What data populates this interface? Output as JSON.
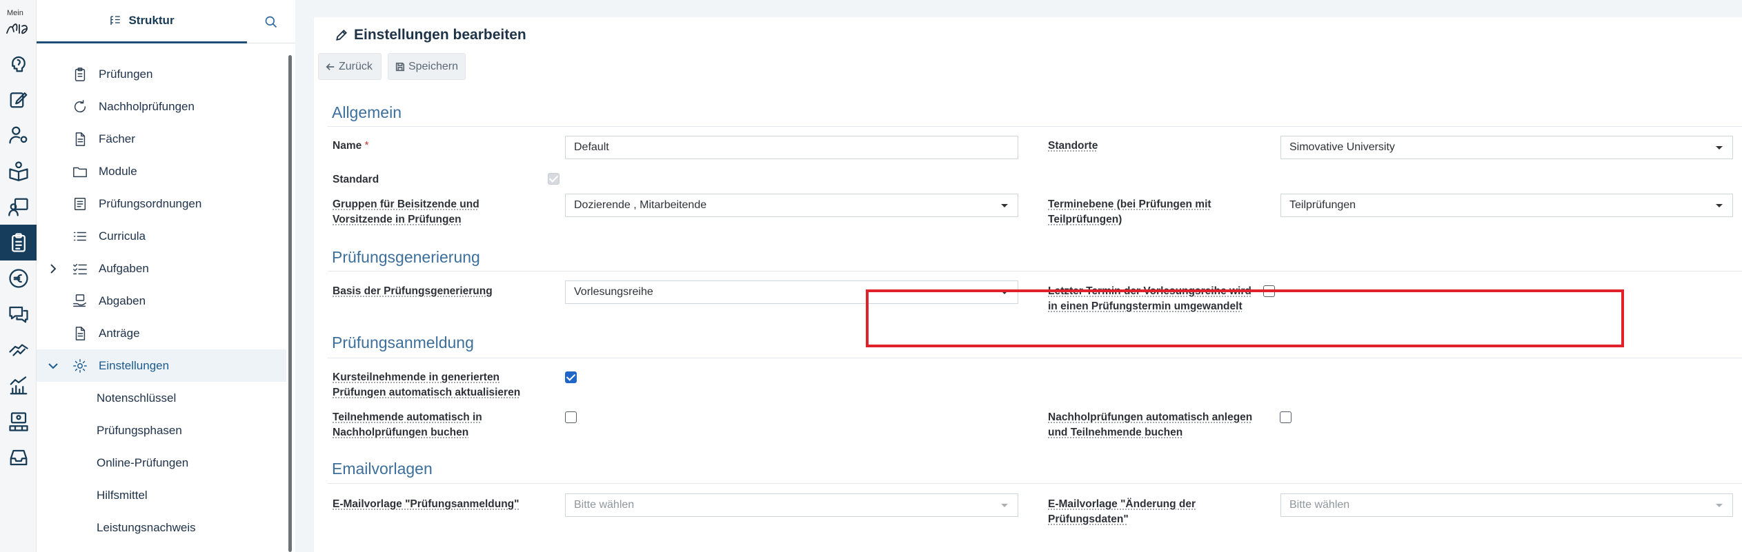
{
  "rail": {
    "logo_text": "Mein",
    "items": [
      {
        "name": "lightbulb-head-icon",
        "active": false
      },
      {
        "name": "edit-icon",
        "active": false
      },
      {
        "name": "user-settings-icon",
        "active": false
      },
      {
        "name": "book-person-icon",
        "active": false
      },
      {
        "name": "teacher-icon",
        "active": false
      },
      {
        "name": "clipboard-icon",
        "active": true
      },
      {
        "name": "euro-icon",
        "active": false
      },
      {
        "name": "chat-icon",
        "active": false
      },
      {
        "name": "handshake-icon",
        "active": false
      },
      {
        "name": "statistics-icon",
        "active": false
      },
      {
        "name": "monitor-person-icon",
        "active": false
      },
      {
        "name": "inbox-icon",
        "active": false
      }
    ]
  },
  "structure": {
    "tab_label": "Struktur",
    "items": [
      {
        "label": "Prüfungen",
        "icon": "clipboard-icon"
      },
      {
        "label": "Nachholprüfungen",
        "icon": "refresh-icon"
      },
      {
        "label": "Fächer",
        "icon": "document-icon"
      },
      {
        "label": "Module",
        "icon": "folder-icon"
      },
      {
        "label": "Prüfungsordnungen",
        "icon": "book-icon"
      },
      {
        "label": "Curricula",
        "icon": "list-icon"
      },
      {
        "label": "Aufgaben",
        "icon": "checklist-icon"
      },
      {
        "label": "Abgaben",
        "icon": "hand-upload-icon"
      },
      {
        "label": "Anträge",
        "icon": "document-icon"
      },
      {
        "label": "Einstellungen",
        "icon": "gear-icon"
      },
      {
        "label": "Notenschlüssel"
      },
      {
        "label": "Prüfungsphasen"
      },
      {
        "label": "Online-Prüfungen"
      },
      {
        "label": "Hilfsmittel"
      },
      {
        "label": "Leistungsnachweis"
      }
    ]
  },
  "page": {
    "title": "Einstellungen bearbeiten",
    "back_label": "Zurück",
    "save_label": "Speichern"
  },
  "sections": {
    "allgemein": {
      "title": "Allgemein",
      "name_label": "Name",
      "name_required": "*",
      "name_value": "Default",
      "standorte_label": "Standorte",
      "standorte_value": "Simovative University",
      "standard_label": "Standard",
      "standard_checked": true,
      "gruppen_label_1": "Gruppen für Beisitzende und",
      "gruppen_label_2": "Vorsitzende in Prüfungen",
      "gruppen_value": "Dozierende , Mitarbeitende",
      "terminebene_label_1": "Terminebene (bei Prüfungen mit",
      "terminebene_label_2": "Teilprüfungen)",
      "terminebene_value": "Teilprüfungen"
    },
    "generierung": {
      "title": "Prüfungsgenerierung",
      "basis_label": "Basis der Prüfungsgenerierung",
      "basis_value": "Vorlesungsreihe",
      "letzter_label_1": "Letzter Termin der Vorlesungsreihe wird",
      "letzter_label_2": "in einen Prüfungstermin umgewandelt",
      "letzter_checked": false
    },
    "anmeldung": {
      "title": "Prüfungsanmeldung",
      "kurs_label_1": "Kursteilnehmende in generierten",
      "kurs_label_2": "Prüfungen automatisch aktualisieren",
      "kurs_checked": true,
      "teilnehmende_label_1": "Teilnehmende automatisch in",
      "teilnehmende_label_2": "Nachholprüfungen buchen",
      "teilnehmende_checked": false,
      "nachhol_label_1": "Nachholprüfungen automatisch anlegen",
      "nachhol_label_2": "und Teilnehmende buchen",
      "nachhol_checked": false
    },
    "email": {
      "title": "Emailvorlagen",
      "anmeldung_label": "E-Mailvorlage \"Prüfungsanmeldung\"",
      "anmeldung_placeholder": "Bitte wählen",
      "aenderung_label_1": "E-Mailvorlage \"Änderung der",
      "aenderung_label_2": "Prüfungsdaten\"",
      "aenderung_placeholder": "Bitte wählen"
    }
  },
  "colors": {
    "accent": "#163d5c",
    "section_title": "#3c6f9b",
    "highlight": "#e0202a",
    "checkbox": "#1f66c8"
  }
}
